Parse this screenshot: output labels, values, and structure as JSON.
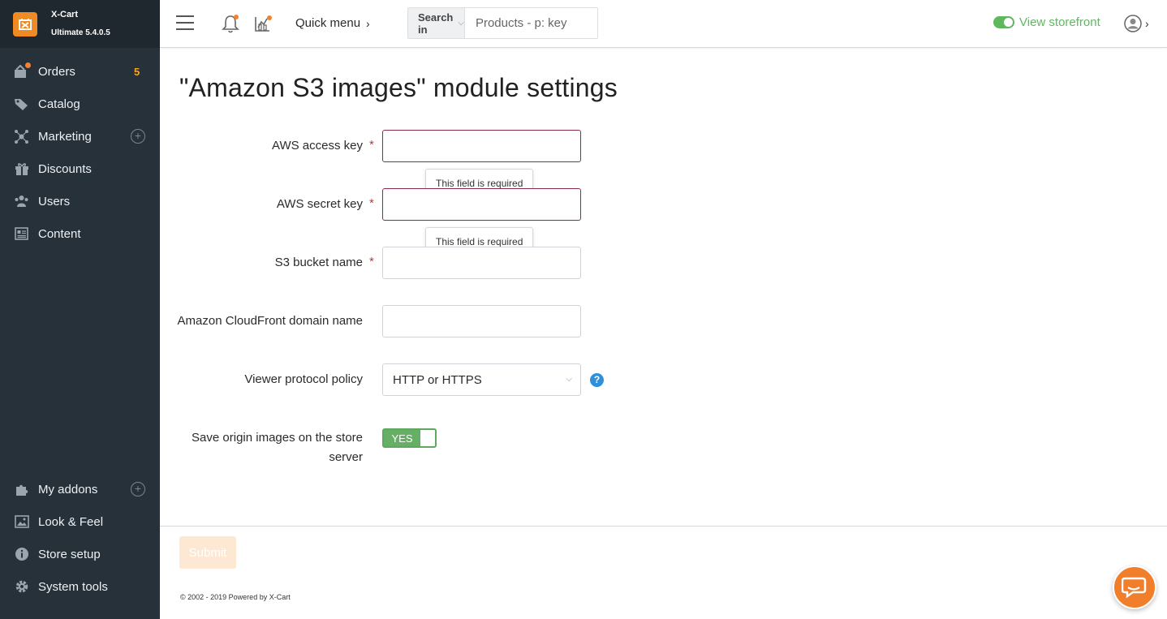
{
  "brand": {
    "name": "X-Cart",
    "version": "Ultimate 5.4.0.5"
  },
  "sidebar": {
    "top_items": [
      {
        "label": "Orders",
        "icon": "orders-icon",
        "badge": "5"
      },
      {
        "label": "Catalog",
        "icon": "tag-icon"
      },
      {
        "label": "Marketing",
        "icon": "marketing-icon",
        "has_plus": true
      },
      {
        "label": "Discounts",
        "icon": "gift-icon"
      },
      {
        "label": "Users",
        "icon": "users-icon"
      },
      {
        "label": "Content",
        "icon": "content-icon"
      }
    ],
    "bottom_items": [
      {
        "label": "My addons",
        "icon": "puzzle-icon",
        "has_plus": true
      },
      {
        "label": "Look & Feel",
        "icon": "image-icon"
      },
      {
        "label": "Store setup",
        "icon": "info-icon"
      },
      {
        "label": "System tools",
        "icon": "gear-icon"
      }
    ]
  },
  "header": {
    "quick_menu": "Quick menu",
    "search_in": "Search in",
    "search_placeholder": "Products - p: key",
    "view_storefront": "View storefront"
  },
  "page": {
    "title": "\"Amazon S3 images\" module settings"
  },
  "form": {
    "fields": [
      {
        "label": "AWS access key",
        "required": true,
        "value": "",
        "error": "This field is required"
      },
      {
        "label": "AWS secret key",
        "required": true,
        "value": "",
        "error": "This field is required"
      },
      {
        "label": "S3 bucket name",
        "required": true,
        "value": ""
      },
      {
        "label": "Amazon CloudFront domain name",
        "required": false,
        "value": ""
      }
    ],
    "protocol": {
      "label": "Viewer protocol policy",
      "value": "HTTP or HTTPS",
      "help": "?"
    },
    "save_origin": {
      "label": "Save origin images on the store server",
      "value": "YES"
    },
    "submit_label": "Submit"
  },
  "footer": {
    "text": "© 2002 - 2019 Powered by X-Cart"
  },
  "colors": {
    "accent": "#f08a24",
    "sidebar_bg": "#26313a",
    "success": "#5fb85f",
    "error_border": "#8a2b4a",
    "required": "#c0392b"
  }
}
